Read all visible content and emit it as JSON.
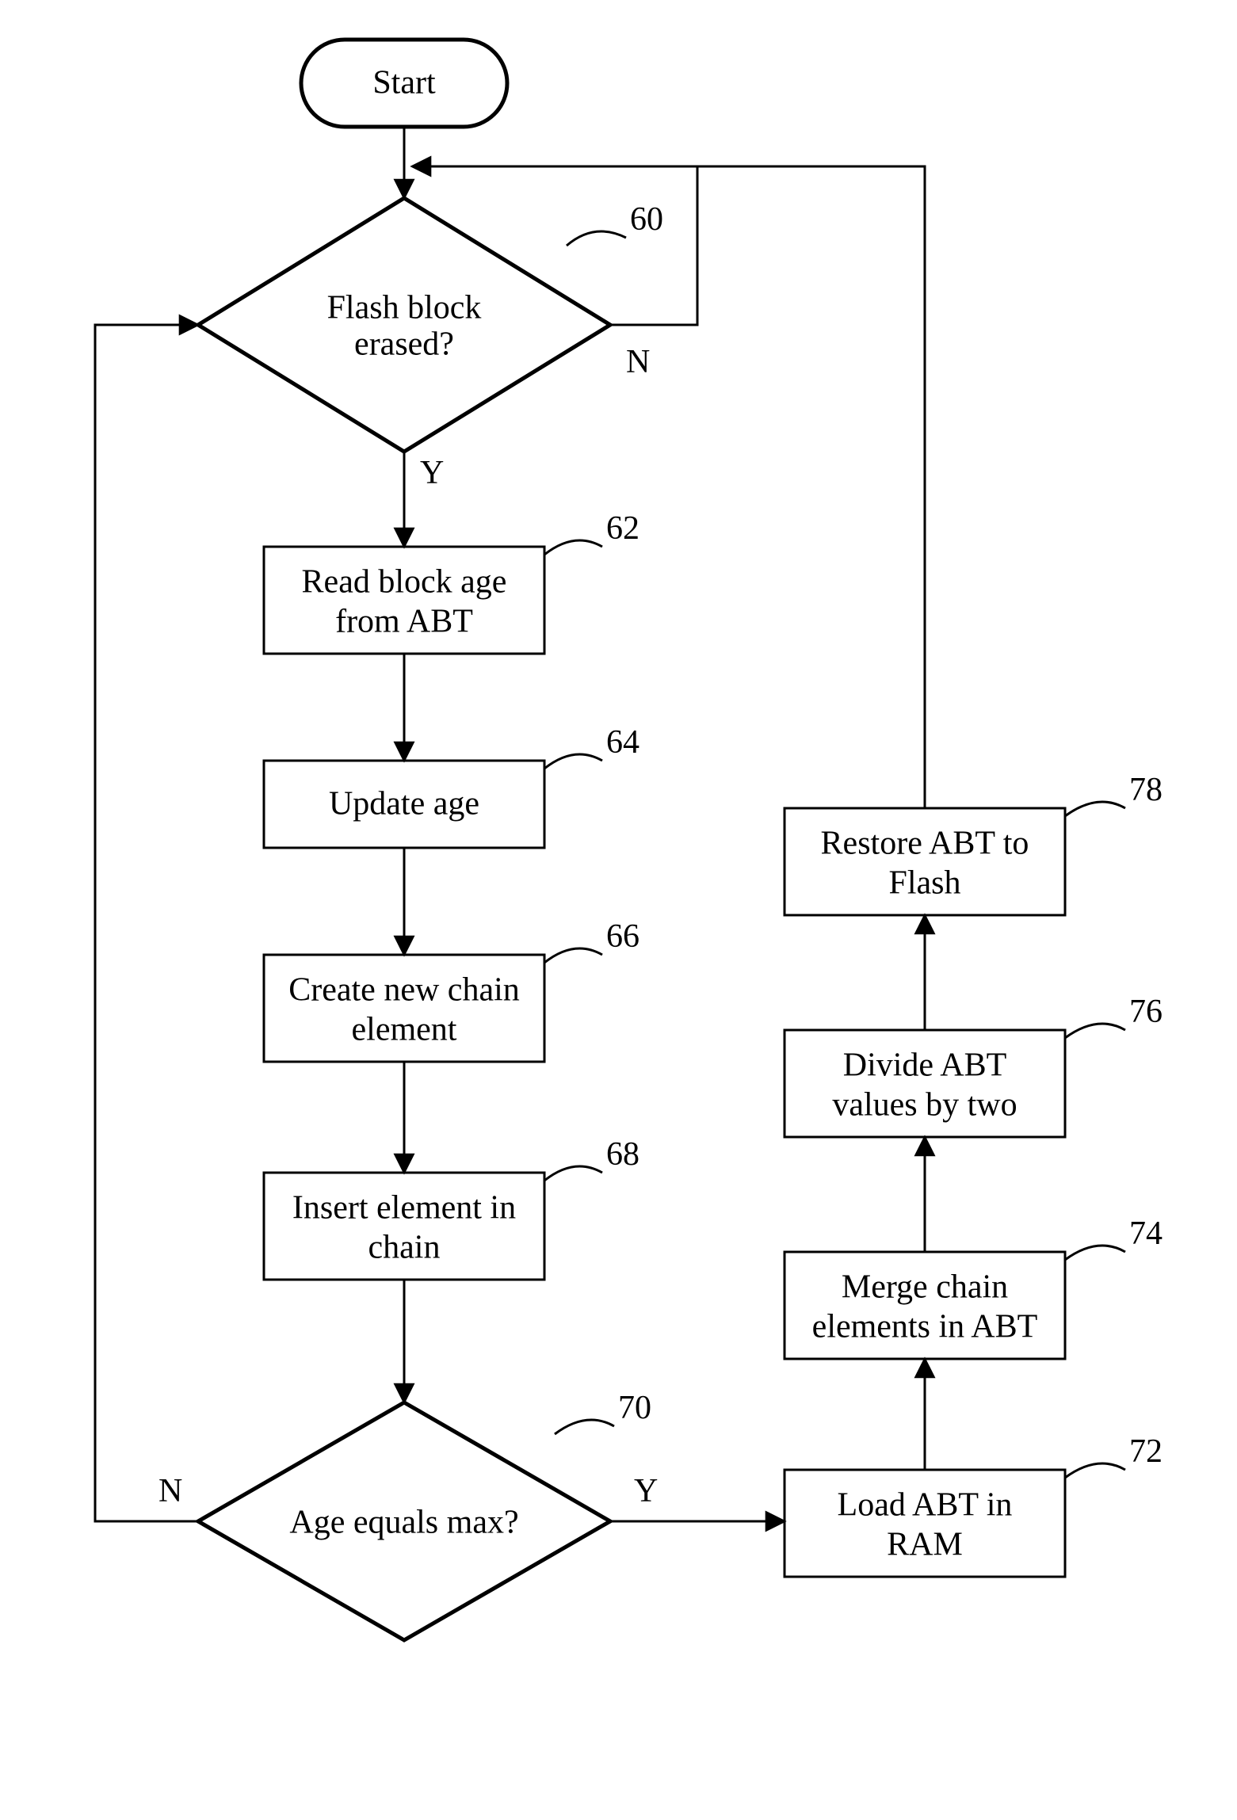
{
  "nodes": {
    "start": "Start",
    "d60": {
      "l1": "Flash block",
      "l2": "erased?",
      "ref": "60",
      "yes": "Y",
      "no": "N"
    },
    "b62": {
      "l1": "Read block age",
      "l2": "from ABT",
      "ref": "62"
    },
    "b64": {
      "l1": "Update age",
      "ref": "64"
    },
    "b66": {
      "l1": "Create new chain",
      "l2": "element",
      "ref": "66"
    },
    "b68": {
      "l1": "Insert element in",
      "l2": "chain",
      "ref": "68"
    },
    "d70": {
      "l1": "Age equals max?",
      "ref": "70",
      "yes": "Y",
      "no": "N"
    },
    "b72": {
      "l1": "Load ABT in",
      "l2": "RAM",
      "ref": "72"
    },
    "b74": {
      "l1": "Merge chain",
      "l2": "elements in ABT",
      "ref": "74"
    },
    "b76": {
      "l1": "Divide ABT",
      "l2": "values by two",
      "ref": "76"
    },
    "b78": {
      "l1": "Restore ABT to",
      "l2": "Flash",
      "ref": "78"
    }
  }
}
